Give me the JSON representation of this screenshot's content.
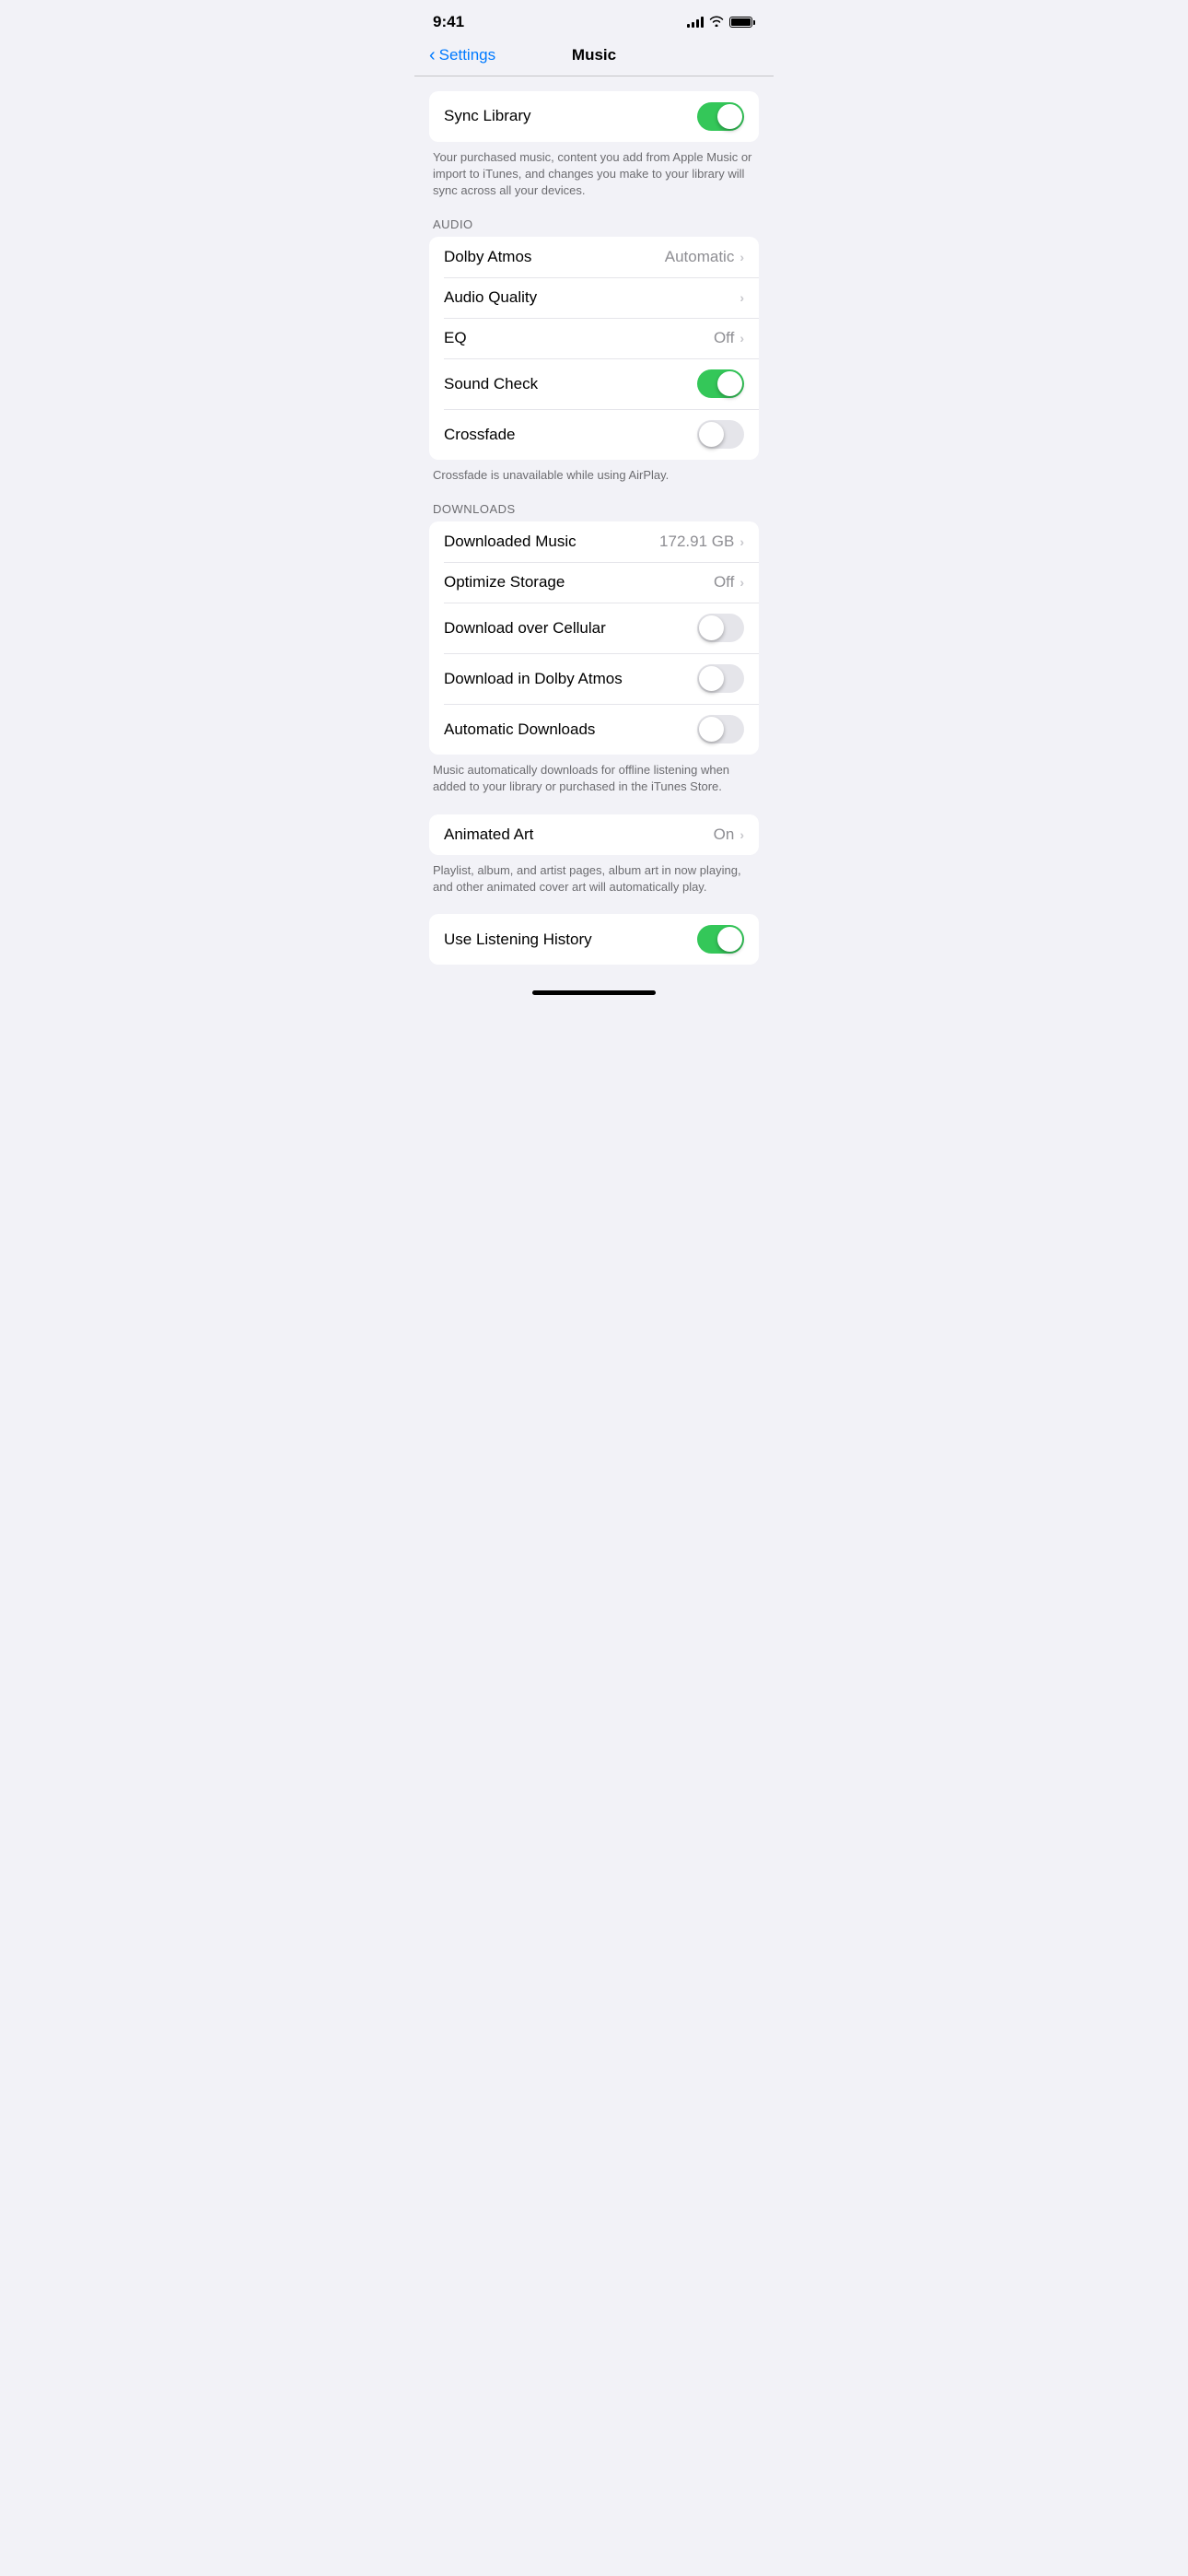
{
  "statusBar": {
    "time": "9:41"
  },
  "header": {
    "backLabel": "Settings",
    "title": "Music"
  },
  "sections": {
    "syncLibrary": {
      "label": "Sync Library",
      "toggleOn": true,
      "footer": "Your purchased music, content you add from Apple Music or import to iTunes, and changes you make to your library will sync across all your devices."
    },
    "audio": {
      "sectionLabel": "AUDIO",
      "rows": [
        {
          "label": "Dolby Atmos",
          "value": "Automatic",
          "hasChevron": true,
          "toggle": null
        },
        {
          "label": "Audio Quality",
          "value": "",
          "hasChevron": true,
          "toggle": null
        },
        {
          "label": "EQ",
          "value": "Off",
          "hasChevron": true,
          "toggle": null
        },
        {
          "label": "Sound Check",
          "value": "",
          "hasChevron": false,
          "toggle": "on"
        },
        {
          "label": "Crossfade",
          "value": "",
          "hasChevron": false,
          "toggle": "off"
        }
      ],
      "footer": "Crossfade is unavailable while using AirPlay."
    },
    "downloads": {
      "sectionLabel": "DOWNLOADS",
      "rows": [
        {
          "label": "Downloaded Music",
          "value": "172.91 GB",
          "hasChevron": true,
          "toggle": null
        },
        {
          "label": "Optimize Storage",
          "value": "Off",
          "hasChevron": true,
          "toggle": null
        },
        {
          "label": "Download over Cellular",
          "value": "",
          "hasChevron": false,
          "toggle": "off"
        },
        {
          "label": "Download in Dolby Atmos",
          "value": "",
          "hasChevron": false,
          "toggle": "off"
        },
        {
          "label": "Automatic Downloads",
          "value": "",
          "hasChevron": false,
          "toggle": "off"
        }
      ],
      "footer": "Music automatically downloads for offline listening when added to your library or purchased in the iTunes Store."
    },
    "animatedArt": {
      "rows": [
        {
          "label": "Animated Art",
          "value": "On",
          "hasChevron": true,
          "toggle": null
        }
      ],
      "footer": "Playlist, album, and artist pages, album art in now playing, and other animated cover art will automatically play."
    },
    "partialBottom": {
      "label": "Use Listening History",
      "toggleOn": true
    }
  },
  "homeIndicator": {}
}
